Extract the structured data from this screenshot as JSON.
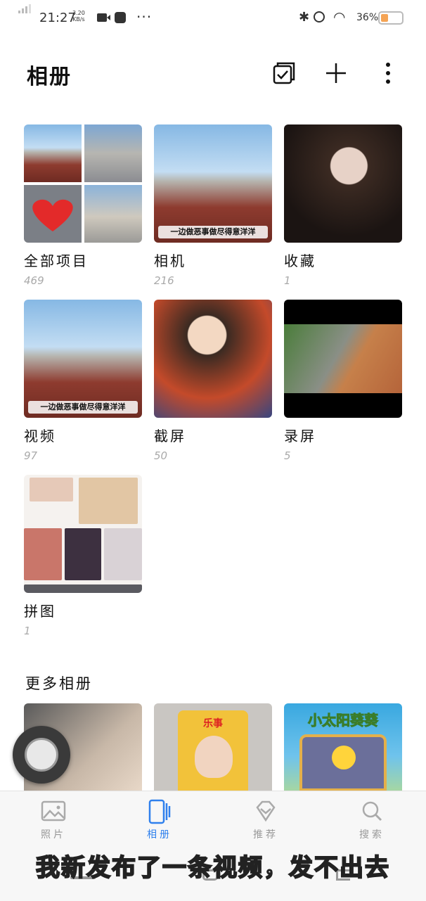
{
  "status_bar": {
    "time": "21:27",
    "speed_value": "3.20",
    "speed_unit": "KB/s",
    "battery_percent": "36%",
    "battery_level": 0.36,
    "dots": "···"
  },
  "header": {
    "title": "相册",
    "icons": [
      "select-icon",
      "add-icon",
      "more-icon"
    ]
  },
  "albums": [
    {
      "name": "全部项目",
      "count": "469",
      "caption": ""
    },
    {
      "name": "相机",
      "count": "216",
      "caption": "一边做恶事做尽得意洋洋"
    },
    {
      "name": "收藏",
      "count": "1",
      "caption": ""
    },
    {
      "name": "视频",
      "count": "97",
      "caption": "一边做恶事做尽得意洋洋"
    },
    {
      "name": "截屏",
      "count": "50",
      "caption": ""
    },
    {
      "name": "录屏",
      "count": "5",
      "caption": ""
    },
    {
      "name": "拼图",
      "count": "1",
      "caption": ""
    }
  ],
  "more_albums": {
    "title": "更多相册",
    "third_thumb_text": "小太阳葵葵",
    "second_thumb_text": "乐事"
  },
  "bottom_nav": [
    {
      "label": "照片",
      "icon": "photo-icon",
      "active": false
    },
    {
      "label": "相册",
      "icon": "album-icon",
      "active": true
    },
    {
      "label": "推荐",
      "icon": "diamond-icon",
      "active": false
    },
    {
      "label": "搜索",
      "icon": "search-icon",
      "active": false
    }
  ],
  "colors": {
    "accent": "#2f80ed",
    "battery": "#f5a455"
  },
  "overlay_caption": "我新发布了一条视频，发不出去"
}
